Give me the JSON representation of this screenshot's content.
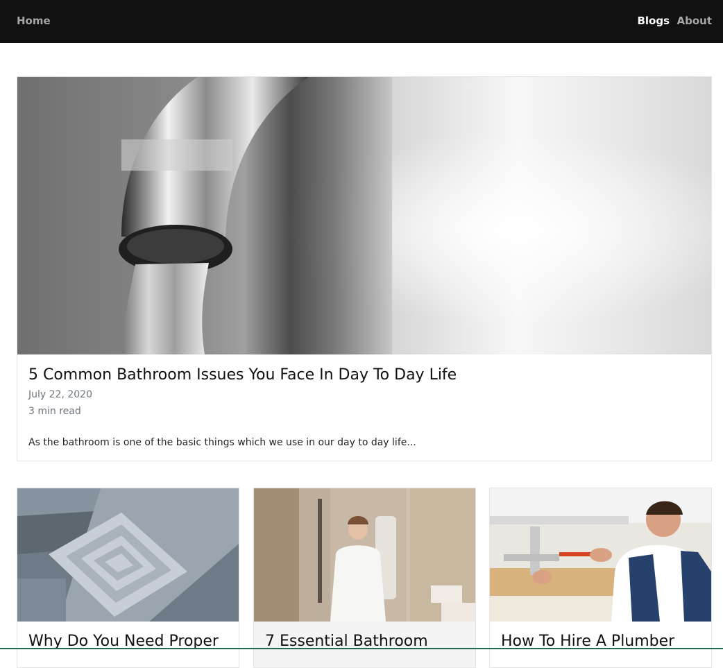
{
  "nav": {
    "home": "Home",
    "blogs": "Blogs",
    "about": "About"
  },
  "featured": {
    "title": "5 Common Bathroom Issues You Face In Day To Day Life",
    "date": "July 22, 2020",
    "read_time": "3 min read",
    "excerpt": "As the bathroom is one of the basic things which we use in our day to day life..."
  },
  "posts": [
    {
      "title": "Why Do You Need Proper"
    },
    {
      "title": "7 Essential Bathroom"
    },
    {
      "title": "How To Hire A Plumber"
    }
  ],
  "colors": {
    "navbar": "#111111",
    "nav_active": "#ffffff",
    "nav_inactive": "#a6a6a6",
    "meta_text": "#6c757d"
  }
}
